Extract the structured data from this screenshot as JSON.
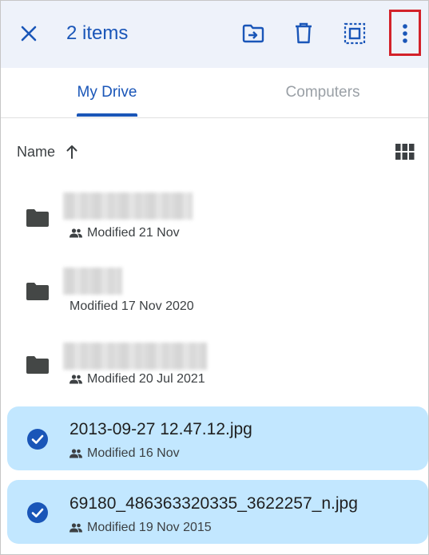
{
  "toolbar": {
    "selection_count": "2 items",
    "icons": [
      "close-icon",
      "move-to-folder-icon",
      "trash-icon",
      "select-all-icon",
      "more-vert-icon"
    ]
  },
  "tabs": [
    {
      "label": "My Drive",
      "active": true
    },
    {
      "label": "Computers",
      "active": false
    }
  ],
  "sort": {
    "label": "Name",
    "direction": "ascending"
  },
  "items": [
    {
      "type": "folder",
      "name": "",
      "shared": true,
      "modified": "Modified 21 Nov",
      "selected": false
    },
    {
      "type": "folder",
      "name": "",
      "shared": false,
      "modified": "Modified 17 Nov 2020",
      "selected": false
    },
    {
      "type": "folder",
      "name": "",
      "shared": true,
      "modified": "Modified 20 Jul 2021",
      "selected": false
    },
    {
      "type": "file",
      "name": "2013-09-27 12.47.12.jpg",
      "shared": true,
      "modified": "Modified 16 Nov",
      "selected": true
    },
    {
      "type": "file",
      "name": "69180_486363320335_3622257_n.jpg",
      "shared": true,
      "modified": "Modified 19 Nov 2015",
      "selected": true
    }
  ],
  "colors": {
    "accent": "#1a56b8",
    "toolbar_bg": "#eef2fa",
    "selected_bg": "#c2e7ff",
    "highlight_box": "#d3222a"
  }
}
